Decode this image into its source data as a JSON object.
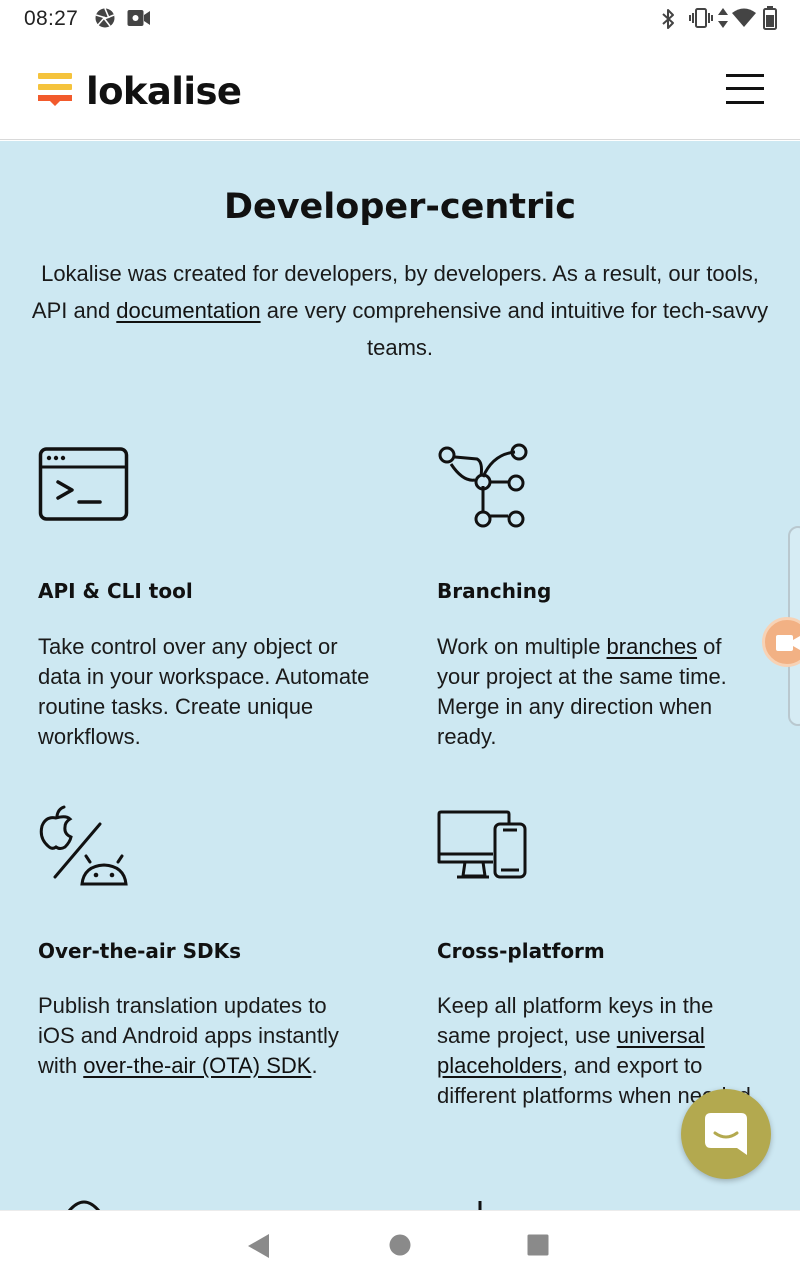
{
  "status_bar": {
    "time": "08:27",
    "left_icons": [
      "aperture-icon",
      "video-camera-icon"
    ],
    "right_icons": [
      "bluetooth-icon",
      "vibrate-icon",
      "data-arrows-icon",
      "wifi-icon",
      "battery-icon"
    ]
  },
  "header": {
    "logo_text": "lokalise",
    "logo_colors": [
      "#f5c33c",
      "#f5c33c",
      "#f25a2c"
    ],
    "menu_icon": "hamburger-menu-icon"
  },
  "section": {
    "title": "Developer-centric",
    "desc_before": "Lokalise was created for developers, by developers. As a result, our tools, API and ",
    "desc_link": "documentation",
    "desc_after": " are very comprehensive and intuitive for tech-savvy teams.",
    "background": "#cde8f2"
  },
  "features": {
    "api": {
      "icon": "terminal-window-icon",
      "title": "API & CLI tool",
      "desc": "Take control over any object or data in your workspace. Automate routine tasks. Create unique workflows."
    },
    "branching": {
      "icon": "git-branch-icon",
      "title": "Branching",
      "desc_before": "Work on multiple ",
      "desc_link": "branches",
      "desc_after": " of your project at the same time. Merge in any direction when ready."
    },
    "ota": {
      "icon": "apple-android-icon",
      "title": "Over-the-air SDKs",
      "desc_before": "Publish translation updates to iOS and Android apps instantly with ",
      "desc_link": "over-the-air (OTA) SDK",
      "desc_after": "."
    },
    "cross": {
      "icon": "desktop-phone-icon",
      "title": "Cross-platform",
      "desc_before": "Keep all platform keys in the same project, use ",
      "desc_link": "universal placeholders",
      "desc_after": ", and export to different platforms when needed."
    }
  },
  "chat": {
    "icon": "chat-bubble-icon",
    "color": "#b3a94f"
  },
  "nav_bar": {
    "icons": [
      "back-triangle-icon",
      "home-circle-icon",
      "recents-square-icon"
    ]
  }
}
